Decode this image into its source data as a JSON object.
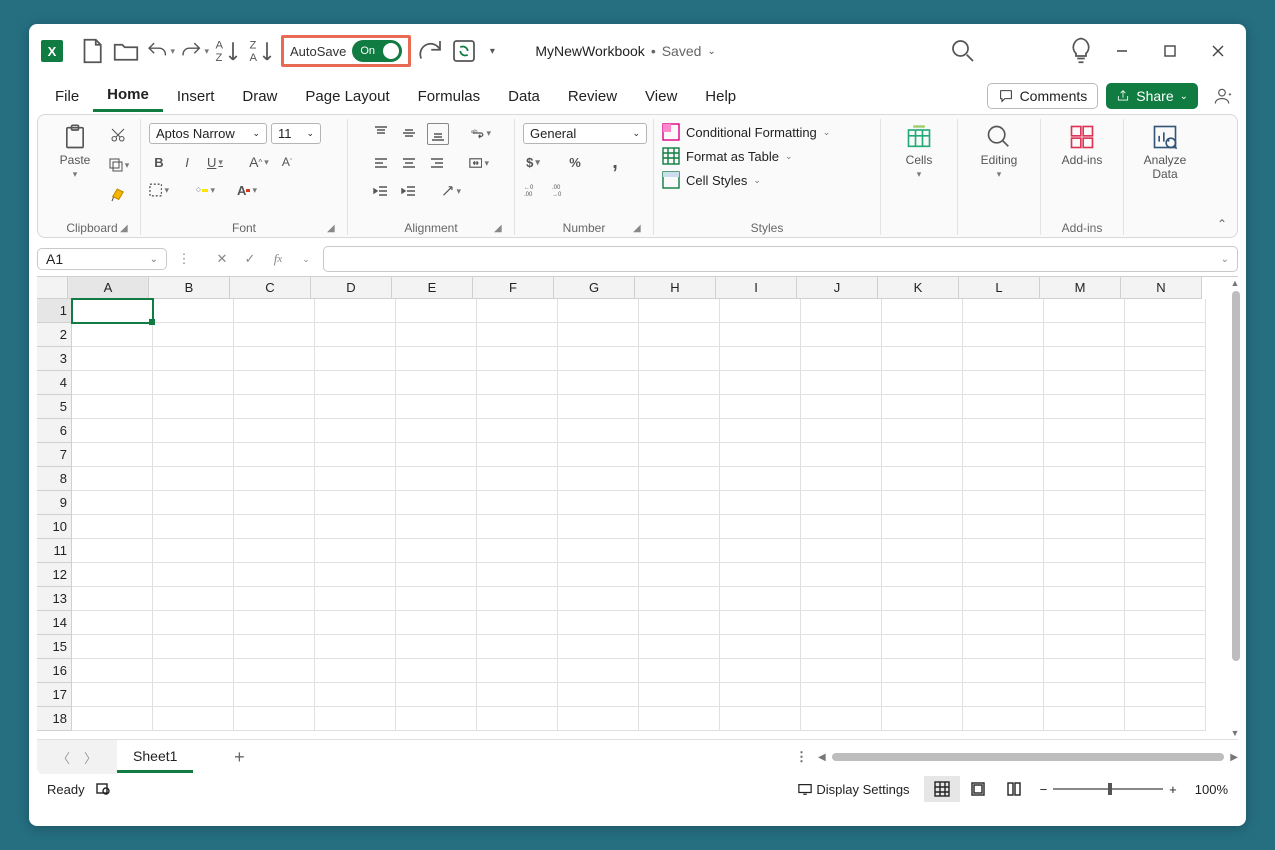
{
  "qat": {
    "autosave_label": "AutoSave",
    "autosave_state": "On"
  },
  "document": {
    "name": "MyNewWorkbook",
    "separator": "•",
    "status": "Saved"
  },
  "tabs": [
    "File",
    "Home",
    "Insert",
    "Draw",
    "Page Layout",
    "Formulas",
    "Data",
    "Review",
    "View",
    "Help"
  ],
  "active_tab": "Home",
  "topright": {
    "comments_label": "Comments",
    "share_label": "Share"
  },
  "ribbon": {
    "clipboard": {
      "label": "Clipboard",
      "paste": "Paste"
    },
    "font": {
      "label": "Font",
      "name": "Aptos Narrow",
      "size": "11"
    },
    "alignment": {
      "label": "Alignment"
    },
    "number": {
      "label": "Number",
      "format": "General"
    },
    "styles": {
      "label": "Styles",
      "cond": "Conditional Formatting",
      "table": "Format as Table",
      "cell": "Cell Styles"
    },
    "cells": {
      "label": "Cells"
    },
    "editing": {
      "label": "Editing"
    },
    "addins": {
      "label": "Add-ins",
      "btn": "Add-ins"
    },
    "analyze": {
      "line1": "Analyze",
      "line2": "Data"
    }
  },
  "formula_bar": {
    "namebox": "A1",
    "value": ""
  },
  "grid": {
    "columns": [
      "A",
      "B",
      "C",
      "D",
      "E",
      "F",
      "G",
      "H",
      "I",
      "J",
      "K",
      "L",
      "M",
      "N"
    ],
    "rows": [
      1,
      2,
      3,
      4,
      5,
      6,
      7,
      8,
      9,
      10,
      11,
      12,
      13,
      14,
      15,
      16,
      17,
      18
    ],
    "selected": "A1"
  },
  "sheets": {
    "active": "Sheet1"
  },
  "status": {
    "ready": "Ready",
    "display": "Display Settings",
    "zoom": "100%"
  }
}
